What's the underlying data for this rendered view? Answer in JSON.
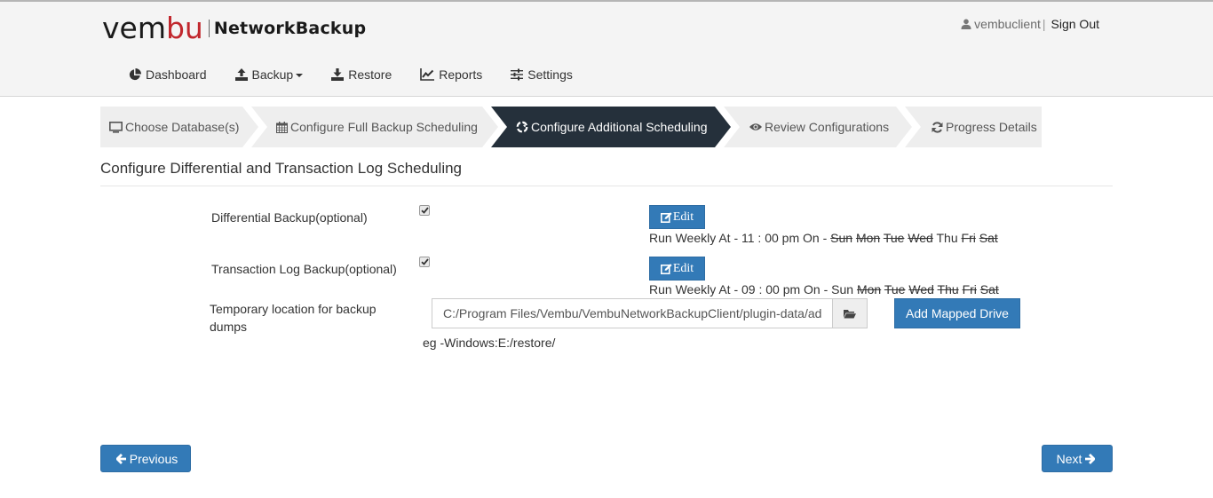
{
  "header": {
    "logo_brand_prefix": "vem",
    "logo_brand_accent": "bu",
    "logo_product": "NetworkBackup",
    "username": "vembuclient",
    "user_separator": "|",
    "sign_out": "Sign Out"
  },
  "nav": {
    "items": [
      {
        "label": "Dashboard",
        "icon": "pie-chart-icon"
      },
      {
        "label": "Backup",
        "icon": "upload-icon",
        "has_dropdown": true
      },
      {
        "label": "Restore",
        "icon": "download-icon"
      },
      {
        "label": "Reports",
        "icon": "line-chart-icon"
      },
      {
        "label": "Settings",
        "icon": "sliders-icon"
      }
    ]
  },
  "wizard": {
    "steps": [
      {
        "label": "Choose Database(s)",
        "icon": "monitor-icon",
        "active": false
      },
      {
        "label": "Configure Full Backup Scheduling",
        "icon": "calendar-icon",
        "active": false
      },
      {
        "label": "Configure Additional Scheduling",
        "icon": "recycle-icon",
        "active": true
      },
      {
        "label": "Review Configurations",
        "icon": "eye-icon",
        "active": false
      },
      {
        "label": "Progress Details",
        "icon": "refresh-icon",
        "active": false
      }
    ],
    "colors": {
      "active_bg": "#25303b",
      "inactive_bg": "#eeeeee"
    }
  },
  "main": {
    "title": "Configure Differential and Transaction Log Scheduling",
    "differential": {
      "label": "Differential Backup(optional)",
      "checked": true,
      "edit_label": "Edit",
      "schedule_prefix": "Run Weekly At - 11 : 00 pm On - ",
      "days": [
        {
          "day": "Sun",
          "enabled": false
        },
        {
          "day": "Mon",
          "enabled": false
        },
        {
          "day": "Tue",
          "enabled": false
        },
        {
          "day": "Wed",
          "enabled": false
        },
        {
          "day": "Thu",
          "enabled": true
        },
        {
          "day": "Fri",
          "enabled": false
        },
        {
          "day": "Sat",
          "enabled": false
        }
      ]
    },
    "transaction_log": {
      "label": "Transaction Log Backup(optional)",
      "checked": true,
      "edit_label": "Edit",
      "schedule_prefix": "Run Weekly At - 09 : 00 pm On - ",
      "days": [
        {
          "day": "Sun",
          "enabled": true
        },
        {
          "day": "Mon",
          "enabled": false
        },
        {
          "day": "Tue",
          "enabled": false
        },
        {
          "day": "Wed",
          "enabled": false
        },
        {
          "day": "Thu",
          "enabled": false
        },
        {
          "day": "Fri",
          "enabled": false
        },
        {
          "day": "Sat",
          "enabled": false
        }
      ]
    },
    "temp_location": {
      "label_line1": "Temporary location for backup",
      "label_line2": "dumps",
      "value": "C:/Program Files/Vembu/VembuNetworkBackupClient/plugin-data/ad",
      "add_mapped_drive": "Add Mapped Drive",
      "hint": "eg -Windows:E:/restore/"
    }
  },
  "footer": {
    "previous": "Previous",
    "next": "Next"
  },
  "colors": {
    "primary": "#337ab7",
    "brand_red": "#c1272d"
  }
}
